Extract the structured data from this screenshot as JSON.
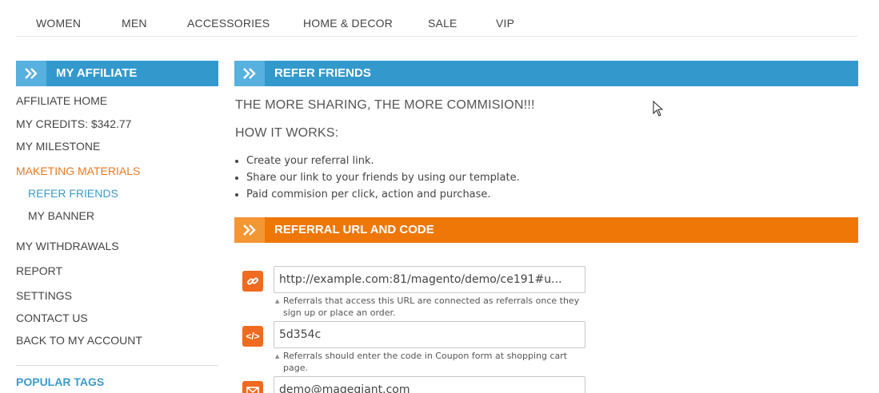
{
  "topnav": {
    "items": [
      "WOMEN",
      "MEN",
      "ACCESSORIES",
      "HOME & DECOR",
      "SALE",
      "VIP"
    ]
  },
  "sidebar": {
    "title": "MY AFFILIATE",
    "items": [
      "AFFILIATE HOME",
      "MY CREDITS: $342.77",
      "MY MILESTONE",
      "MAKETING MATERIALS",
      "REFER FRIENDS",
      "MY BANNER",
      "MY WITHDRAWALS",
      "REPORT",
      "SETTINGS",
      "CONTACT US",
      "BACK TO MY ACCOUNT"
    ],
    "popular_tags": "POPULAR TAGS"
  },
  "main": {
    "refer_title": "REFER FRIENDS",
    "headline1": "THE MORE SHARING, THE MORE COMMISION!!!",
    "headline2": "HOW IT WORKS:",
    "steps": [
      "Create your referral link.",
      "Share our link to your friends by using our template.",
      "Paid commision per click, action and purchase."
    ],
    "referral_title": "REFERRAL URL AND CODE",
    "url_value": "http://example.com:81/magento/demo/ce191#u...",
    "url_hint": "Referrals that access this URL are connected as referrals once they sign up or place an order.",
    "code_value": "5d354c",
    "code_hint": "Referrals should enter the code in Coupon form at shopping cart page.",
    "email_value": "demo@magegiant.com"
  },
  "colors": {
    "blue": "#3399cc",
    "orange": "#ee7708",
    "link_orange": "#e87a23",
    "link_blue": "#3d9bc6"
  },
  "icons": [
    "double-chevron-right-icon",
    "link-icon",
    "code-icon",
    "mail-icon",
    "mouse-cursor-icon"
  ]
}
